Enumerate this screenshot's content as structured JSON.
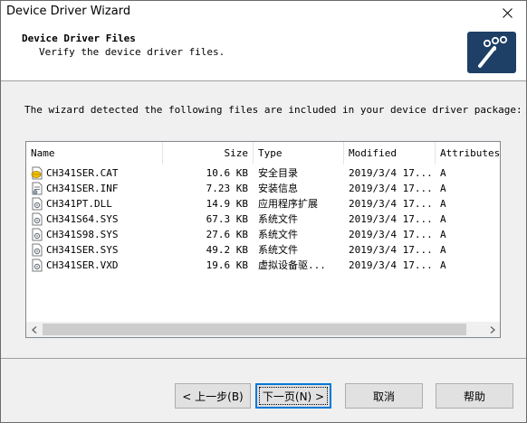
{
  "window": {
    "title": "Device Driver Wizard"
  },
  "header": {
    "title": "Device Driver Files",
    "subtitle": "Verify the device driver files."
  },
  "intro_text": "The wizard detected the following files are included in your device driver package:",
  "list": {
    "columns": [
      "Name",
      "Size",
      "Type",
      "Modified",
      "Attributes"
    ],
    "rows": [
      {
        "name": "CH341SER.CAT",
        "size": "10.6 KB",
        "type": "安全目录",
        "modified": "2019/3/4 17...",
        "attr": "A",
        "icon": "security-catalog-icon"
      },
      {
        "name": "CH341SER.INF",
        "size": "7.23 KB",
        "type": "安装信息",
        "modified": "2019/3/4 17...",
        "attr": "A",
        "icon": "setup-info-icon"
      },
      {
        "name": "CH341PT.DLL",
        "size": "14.9 KB",
        "type": "应用程序扩展",
        "modified": "2019/3/4 17...",
        "attr": "A",
        "icon": "system-file-icon"
      },
      {
        "name": "CH341S64.SYS",
        "size": "67.3 KB",
        "type": "系统文件",
        "modified": "2019/3/4 17...",
        "attr": "A",
        "icon": "system-file-icon"
      },
      {
        "name": "CH341S98.SYS",
        "size": "27.6 KB",
        "type": "系统文件",
        "modified": "2019/3/4 17...",
        "attr": "A",
        "icon": "system-file-icon"
      },
      {
        "name": "CH341SER.SYS",
        "size": "49.2 KB",
        "type": "系统文件",
        "modified": "2019/3/4 17...",
        "attr": "A",
        "icon": "system-file-icon"
      },
      {
        "name": "CH341SER.VXD",
        "size": "19.6 KB",
        "type": "虚拟设备驱...",
        "modified": "2019/3/4 17...",
        "attr": "A",
        "icon": "system-file-icon"
      }
    ]
  },
  "buttons": {
    "back": "< 上一步(B)",
    "next": "下一页(N) >",
    "cancel": "取消",
    "help": "帮助"
  },
  "colors": {
    "logo_bg": "#1e3f66",
    "accent": "#0078d7"
  }
}
